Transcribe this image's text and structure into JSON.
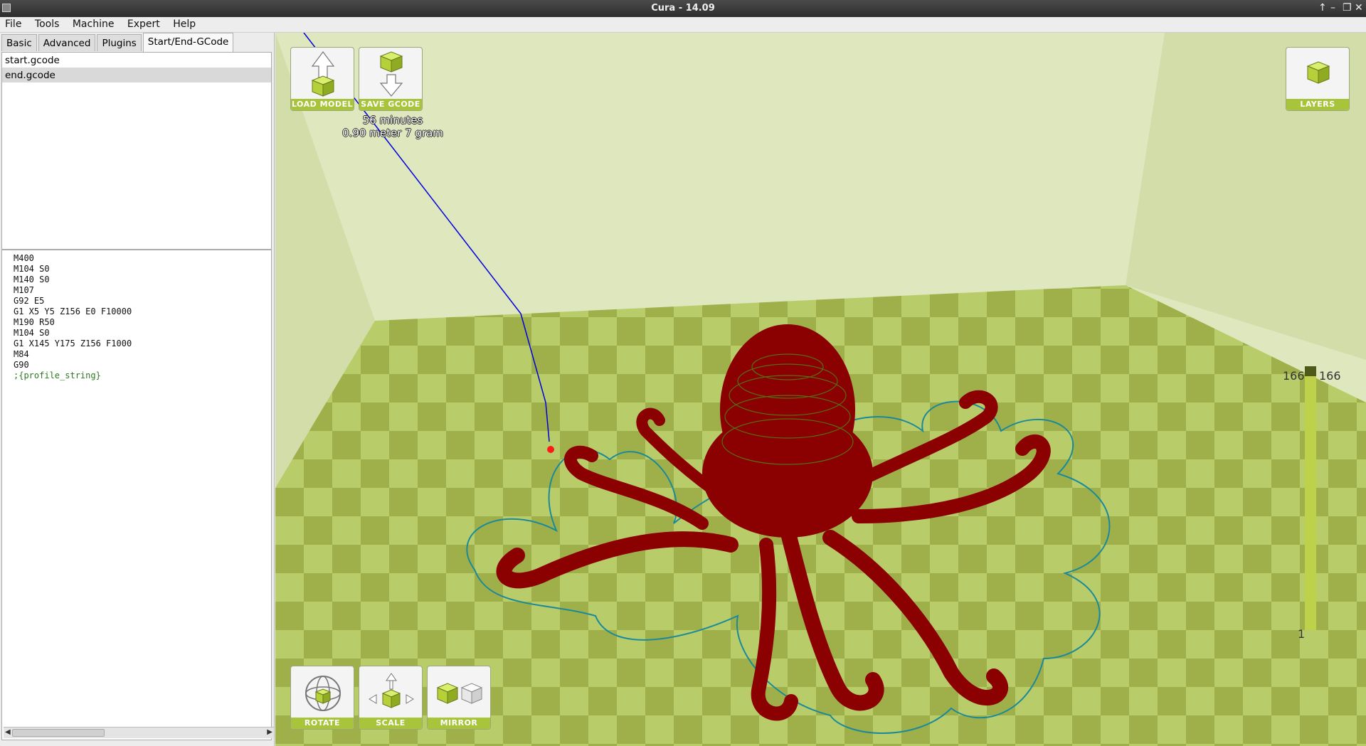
{
  "window": {
    "title": "Cura - 14.09"
  },
  "menu": [
    "File",
    "Tools",
    "Machine",
    "Expert",
    "Help"
  ],
  "tabs": [
    "Basic",
    "Advanced",
    "Plugins",
    "Start/End-GCode"
  ],
  "files": [
    "start.gcode",
    "end.gcode"
  ],
  "code": [
    "M400",
    "M104 S0",
    "M140 S0",
    "M107",
    "G92 E5",
    "G1 X5 Y5 Z156 E0 F10000",
    "M190 R50",
    "M104 S0",
    "G1 X145 Y175 Z156 F1000",
    "M84",
    "G90",
    ";{profile_string}"
  ],
  "toolbar": {
    "load": "LOAD MODEL",
    "save": "SAVE GCODE",
    "layers": "LAYERS",
    "rotate": "ROTATE",
    "scale": "SCALE",
    "mirror": "MIRROR"
  },
  "print_info": {
    "time": "56 minutes",
    "material": "0.90 meter 7 gram"
  },
  "layer_slider": {
    "current_left": "166",
    "current_right": "166",
    "min": "1"
  },
  "colors": {
    "accent": "#a8c43a",
    "model": "#8b0000",
    "travel": "#0000dd"
  }
}
